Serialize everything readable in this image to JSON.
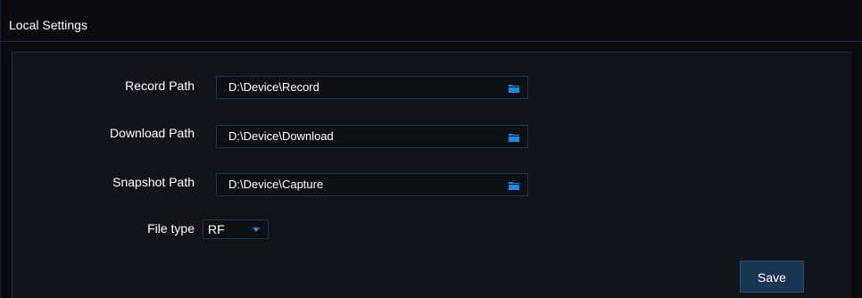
{
  "header": {
    "title": "Local Settings"
  },
  "settings": {
    "record_path": {
      "label": "Record Path",
      "value": "D:\\Device\\Record",
      "icon": "folder-icon"
    },
    "download_path": {
      "label": "Download Path",
      "value": "D:\\Device\\Download",
      "icon": "folder-icon"
    },
    "snapshot_path": {
      "label": "Snapshot Path",
      "value": "D:\\Device\\Capture",
      "icon": "folder-icon"
    },
    "file_type": {
      "label": "File type",
      "selected": "RF"
    }
  },
  "actions": {
    "save_label": "Save"
  },
  "colors": {
    "accent": "#1e88e5",
    "background": "#0b0c0f",
    "panel": "#11151b",
    "border": "#1c3552",
    "button": "#1a3553"
  }
}
